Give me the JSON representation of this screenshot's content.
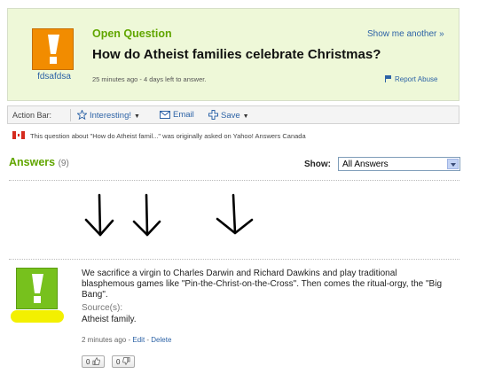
{
  "question": {
    "header": "Open Question",
    "show_another": "Show me another »",
    "title": "How do Atheist families celebrate Christmas?",
    "meta": "25 minutes ago - 4 days left to answer.",
    "report_abuse": "Report Abuse",
    "asker": {
      "name": "fdsafdsa",
      "avatar_color": "#f28c00"
    }
  },
  "action_bar": {
    "label": "Action Bar:",
    "interesting": "Interesting!",
    "email": "Email",
    "save": "Save"
  },
  "origin_note": "This question about \"How do Atheist famil...\" was originally asked on Yahoo! Answers Canada",
  "answers": {
    "heading": "Answers",
    "count": "(9)",
    "show_label": "Show:",
    "show_selected": "All Answers"
  },
  "answer": {
    "avatar_color": "#77c11d",
    "text": "We sacrifice a virgin to Charles Darwin and Richard Dawkins and play traditional blasphemous games like \"Pin-the-Christ-on-the-Cross\". Then comes the ritual-orgy, the \"Big Bang\".",
    "source_label": "Source(s):",
    "source": "Atheist family.",
    "time": "2 minutes ago - ",
    "edit": "Edit",
    "delete": "Delete",
    "thumbs_up": "0",
    "thumbs_down": "0"
  },
  "colors": {
    "accent_green": "#61a600",
    "link_blue": "#2d63a6",
    "question_bg": "#eef8d8",
    "highlight": "#f3f000"
  }
}
